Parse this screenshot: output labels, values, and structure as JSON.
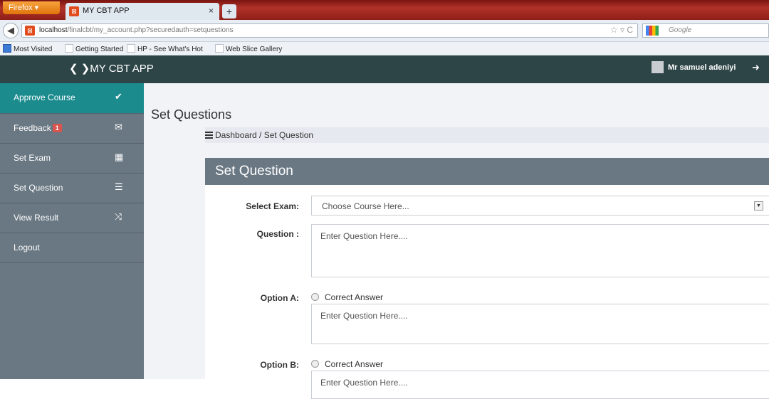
{
  "browser": {
    "menu_label": "Firefox ▾",
    "tab_title": "MY CBT APP",
    "tab_close": "×",
    "new_tab": "+",
    "url_host": "localhost",
    "url_path": "/finalcbt/my_account.php?securedauth=setquestions",
    "search_placeholder": "Google",
    "bookmarks": [
      "Most Visited",
      "Getting Started",
      "HP - See What's Hot",
      "Web Slice Gallery"
    ]
  },
  "header": {
    "brand": "❮ ❯MY CBT APP",
    "user_name": "Mr samuel adeniyi"
  },
  "sidebar": {
    "items": [
      {
        "label": "Approve Course",
        "icon": "check-icon"
      },
      {
        "label": "Feedback",
        "badge": "1",
        "icon": "envelope-icon"
      },
      {
        "label": "Set Exam",
        "icon": "grid-icon"
      },
      {
        "label": "Set Question",
        "icon": "list-icon"
      },
      {
        "label": "View Result",
        "icon": "shuffle-icon"
      },
      {
        "label": "Logout"
      }
    ]
  },
  "main": {
    "page_title": "Set Questions",
    "breadcrumb": "Dashboard / Set Question",
    "panel_title": "Set Question",
    "form": {
      "select_exam_label": "Select Exam:",
      "select_exam_value": "Choose Course Here...",
      "question_label": "Question :",
      "question_placeholder": "Enter Question Here....",
      "option_a_label": "Option A:",
      "option_a_correct": "Correct Answer",
      "option_a_placeholder": "Enter Question Here....",
      "option_b_label": "Option B:",
      "option_b_correct": "Correct Answer",
      "option_b_placeholder": "Enter Question Here...."
    }
  }
}
